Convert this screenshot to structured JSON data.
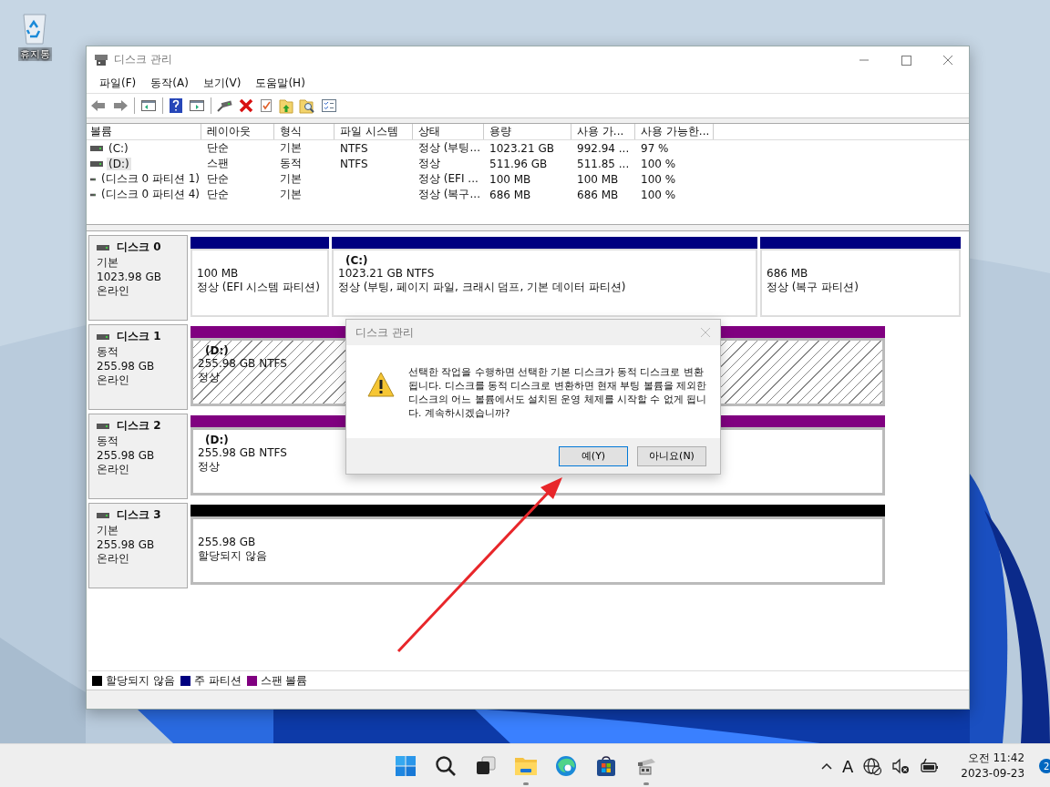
{
  "desktop_icons": [
    {
      "label": "휴지통"
    }
  ],
  "window": {
    "title": "디스크 관리",
    "menu": [
      "파일(F)",
      "동작(A)",
      "보기(V)",
      "도움말(H)"
    ],
    "volume_table": {
      "columns": [
        "볼륨",
        "레이아웃",
        "형식",
        "파일 시스템",
        "상태",
        "용량",
        "사용 가...",
        "사용 가능한..."
      ],
      "rows": [
        {
          "selected": false,
          "cells": [
            "(C:)",
            "단순",
            "기본",
            "NTFS",
            "정상 (부팅...",
            "1023.21 GB",
            "992.94 ...",
            "97 %"
          ]
        },
        {
          "selected": true,
          "cells": [
            "(D:)",
            "스팬",
            "동적",
            "NTFS",
            "정상",
            "511.96 GB",
            "511.85 ...",
            "100 %"
          ]
        },
        {
          "selected": false,
          "cells": [
            "(디스크 0 파티션 1)",
            "단순",
            "기본",
            "",
            "정상 (EFI ...",
            "100 MB",
            "100 MB",
            "100 %"
          ]
        },
        {
          "selected": false,
          "cells": [
            "(디스크 0 파티션 4)",
            "단순",
            "기본",
            "",
            "정상 (복구...",
            "686 MB",
            "686 MB",
            "100 %"
          ]
        }
      ]
    },
    "disks": [
      {
        "name": "디스크 0",
        "type": "기본",
        "size": "1023.98 GB",
        "status": "온라인",
        "partitions": [
          {
            "kind": "primary",
            "selected": false,
            "size": "100 MB",
            "status": "정상 (EFI 시스템 파티션)"
          },
          {
            "kind": "primary",
            "selected": false,
            "label": "(C:)",
            "size": "1023.21 GB NTFS",
            "status": "정상 (부팅, 페이지 파일, 크래시 덤프, 기본 데이터 파티션)"
          },
          {
            "kind": "primary",
            "selected": false,
            "size": "686 MB",
            "status": "정상 (복구 파티션)"
          }
        ]
      },
      {
        "name": "디스크 1",
        "type": "동적",
        "size": "255.98 GB",
        "status": "온라인",
        "partitions": [
          {
            "kind": "spanned",
            "selected": true,
            "label": "(D:)",
            "size": "255.98 GB NTFS",
            "status": "정상"
          }
        ]
      },
      {
        "name": "디스크 2",
        "type": "동적",
        "size": "255.98 GB",
        "status": "온라인",
        "partitions": [
          {
            "kind": "spanned",
            "selected": false,
            "label": "(D:)",
            "size": "255.98 GB NTFS",
            "status": "정상"
          }
        ]
      },
      {
        "name": "디스크 3",
        "type": "기본",
        "size": "255.98 GB",
        "status": "온라인",
        "partitions": [
          {
            "kind": "unallocated",
            "selected": false,
            "size": "255.98 GB",
            "status": "할당되지 않음"
          }
        ]
      }
    ],
    "legend": [
      {
        "kind": "unallocated",
        "label": "할당되지 않음",
        "color": "#000000"
      },
      {
        "kind": "primary",
        "label": "주 파티션",
        "color": "#000080"
      },
      {
        "kind": "spanned",
        "label": "스팬 볼륨",
        "color": "#800080"
      }
    ],
    "dialog": {
      "title": "디스크 관리",
      "message": "선택한 작업을 수행하면 선택한 기본 디스크가 동적 디스크로 변환됩니다. 디스크를 동적 디스크로 변환하면 현재 부팅 볼륨을 제외한 디스크의 어느 볼륨에서도 설치된 운영 체제를 시작할 수 없게 됩니다. 계속하시겠습니까?",
      "buttons": [
        {
          "label": "예(Y)",
          "default": true
        },
        {
          "label": "아니요(N)",
          "default": false
        }
      ]
    }
  },
  "taskbar": {
    "apps": [
      {
        "kind": "start",
        "running": false
      },
      {
        "kind": "search",
        "running": false
      },
      {
        "kind": "taskview",
        "running": false
      },
      {
        "kind": "explorer",
        "running": true
      },
      {
        "kind": "edge",
        "running": false
      },
      {
        "kind": "store",
        "running": false
      },
      {
        "kind": "diskmgmt",
        "running": true
      }
    ],
    "ime": "A",
    "time": "오전 11:42",
    "date": "2023-09-23",
    "notifications": "2"
  }
}
